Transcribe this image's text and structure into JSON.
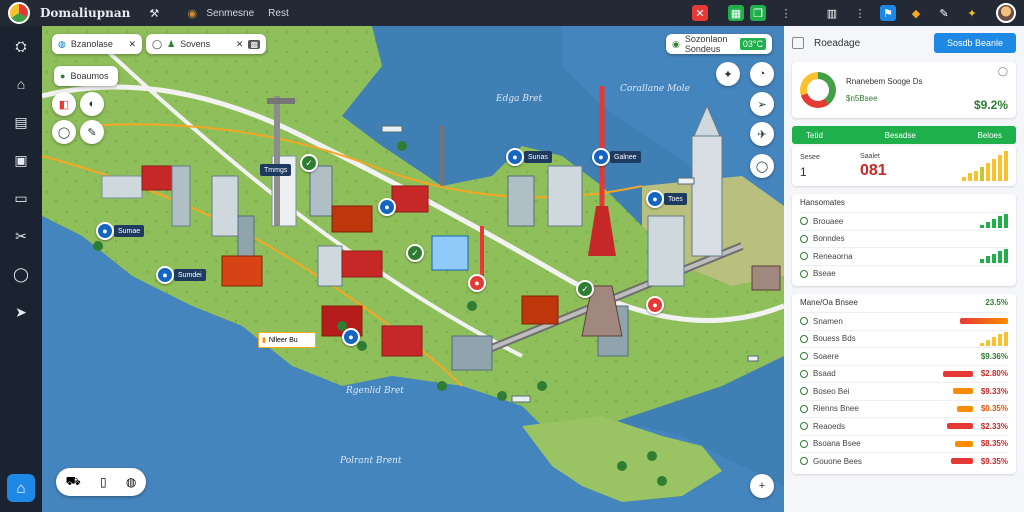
{
  "app": {
    "title": "Domaliupnan",
    "menu_1": "Senmesne",
    "menu_2": "Rest"
  },
  "toolbar_right": {
    "icons": [
      "close-icon",
      "grid-icon",
      "copy-icon",
      "more-icon",
      "building-icon",
      "more-icon",
      "flag-icon",
      "pin-icon",
      "tools-icon",
      "settings-icon"
    ]
  },
  "sidebar": {
    "items": [
      "layers-icon",
      "home-icon",
      "clipboard-icon",
      "document-icon",
      "monitor-icon",
      "tools-icon",
      "shield-icon",
      "navigate-icon"
    ],
    "home_icon": "home-icon"
  },
  "map": {
    "search_1": {
      "text": "Bzanolase"
    },
    "search_2": {
      "text": "Sovens"
    },
    "top_chip": {
      "text": "Sozonlaon Sondeus",
      "badge": "03°C"
    },
    "layer_chip": {
      "text": "Boaumos"
    },
    "labels": {
      "water_1": "Edga Bret",
      "water_2": "Corallane Mole",
      "water_3": "Rgenlid Bret",
      "water_4": "Polrant Brent"
    },
    "pin_labels": [
      "Sumae",
      "Sumdei",
      "Tmmgs",
      "Sunas",
      "Galnee",
      "Toes"
    ],
    "callout": "Nlleer Bu"
  },
  "panel": {
    "title": "Roeadage",
    "action_button": "Sosdb Beanle",
    "summary": {
      "heading": "Rnanebem Sooge Ds",
      "sub": "$n5Bsee",
      "value": "$9.2%"
    },
    "green_bar": {
      "c1": "Tetid",
      "c2": "Besadse",
      "c3": "Beloes"
    },
    "kpi": {
      "label_1": "Sesee",
      "label_2": "Saalet",
      "value_1": "1",
      "value_2": "081"
    },
    "section_1": {
      "title": "Hansomates",
      "items": [
        {
          "label": "Brouaee"
        },
        {
          "label": "Bonndes"
        },
        {
          "label": "Reneaorna"
        },
        {
          "label": "Bseae"
        }
      ]
    },
    "section_2": {
      "title": "Mane/Oa Bnsee",
      "value": "23.5%",
      "items": [
        {
          "label": "Snamen"
        },
        {
          "label": "Bouess Bds"
        },
        {
          "label": "Soaere",
          "value": "$9.36%"
        },
        {
          "label": "Bsaad",
          "value": "$2.80%"
        },
        {
          "label": "Boseo Bei",
          "value": "$9.33%"
        },
        {
          "label": "Rienns Bnee",
          "value": "$0.35%"
        },
        {
          "label": "Reaoeds",
          "value": "$2.33%"
        },
        {
          "label": "Bsoana Bsee",
          "value": "$8.35%"
        },
        {
          "label": "Gouone Bees",
          "value": "$9.35%"
        }
      ]
    }
  },
  "colors": {
    "accent": "#1e88e5",
    "green": "#1fb04b",
    "red": "#e53935",
    "yellow": "#fbc02d",
    "orange": "#fb8c00"
  }
}
